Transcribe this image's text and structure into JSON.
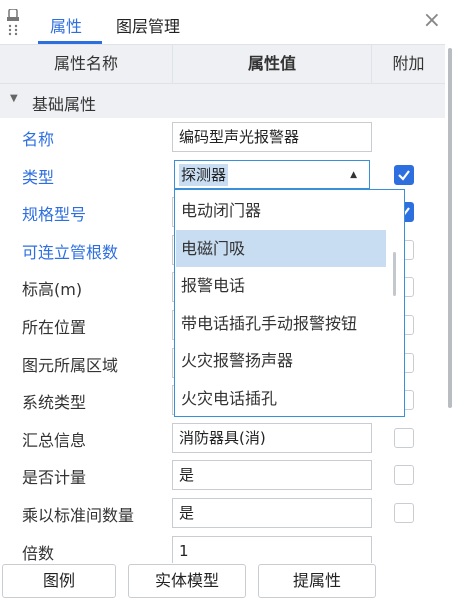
{
  "tabs": [
    {
      "label": "属性",
      "active": true
    },
    {
      "label": "图层管理",
      "active": false
    }
  ],
  "close_glyph": "×",
  "columns": {
    "name": "属性名称",
    "value": "属性值",
    "extra": "附加"
  },
  "group": {
    "label": "基础属性",
    "expanded": true
  },
  "properties": [
    {
      "name": "名称",
      "value": "编码型声光报警器",
      "highlight": true,
      "checkbox": null
    },
    {
      "name": "类型",
      "value": "探测器",
      "highlight": true,
      "checkbox": true
    },
    {
      "name": "规格型号",
      "value": "",
      "highlight": true,
      "checkbox": true
    },
    {
      "name": "可连立管根数",
      "value": "",
      "highlight": true,
      "checkbox": false
    },
    {
      "name": "标高(m)",
      "value": "",
      "highlight": false,
      "checkbox": false
    },
    {
      "name": "所在位置",
      "value": "",
      "highlight": false,
      "checkbox": false
    },
    {
      "name": "图元所属区域",
      "value": "",
      "highlight": false,
      "checkbox": false
    },
    {
      "name": "系统类型",
      "value": "",
      "highlight": false,
      "checkbox": false
    },
    {
      "name": "汇总信息",
      "value": "消防器具(消)",
      "highlight": false,
      "checkbox": false
    },
    {
      "name": "是否计量",
      "value": "是",
      "highlight": false,
      "checkbox": false
    },
    {
      "name": "乘以标准间数量",
      "value": "是",
      "highlight": false,
      "checkbox": false
    },
    {
      "name": "倍数",
      "value": "1",
      "highlight": false,
      "checkbox": null
    }
  ],
  "type_dropdown": {
    "current": "探测器",
    "options": [
      "电动闭门器",
      "电磁门吸",
      "报警电话",
      "带电话插孔手动报警按钮",
      "火灾报警扬声器",
      "火灾电话插孔"
    ],
    "hovered_index": 1
  },
  "footer_buttons": [
    "图例",
    "实体模型",
    "提属性"
  ],
  "colors": {
    "accent": "#2e6fe0",
    "header_bg": "#eef0f3",
    "selection": "#c8dcf2",
    "border": "#c9cdd2"
  }
}
